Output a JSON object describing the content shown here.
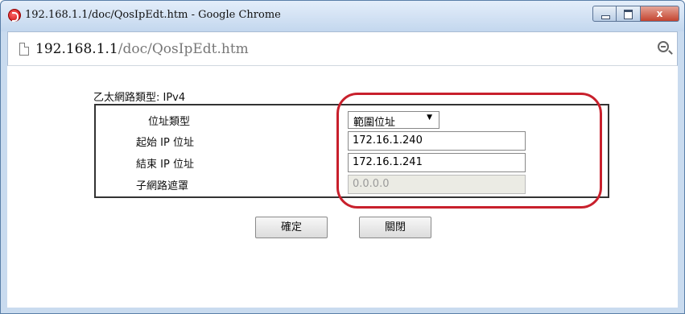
{
  "window": {
    "title": "192.168.1.1/doc/QosIpEdt.htm - Google Chrome",
    "close_label": "x"
  },
  "address": {
    "host": "192.168.1.1",
    "path": "/doc/QosIpEdt.htm"
  },
  "form": {
    "ethernet_type": "乙太網路類型: IPv4",
    "address_type_label": "位址類型",
    "address_type_value": "範圍位址",
    "start_ip_label": "起始 IP 位址",
    "start_ip_value": "172.16.1.240",
    "end_ip_label": "結束 IP 位址",
    "end_ip_value": "172.16.1.241",
    "subnet_mask_label": "子網路遮罩",
    "subnet_mask_value": "0.0.0.0"
  },
  "buttons": {
    "ok": "確定",
    "close": "關閉"
  },
  "icons": {
    "app": "dlink-icon",
    "page": "page-icon",
    "zoom": "zoom-icon"
  },
  "colors": {
    "highlight": "#c8202c",
    "frame": "#c9dbef"
  }
}
